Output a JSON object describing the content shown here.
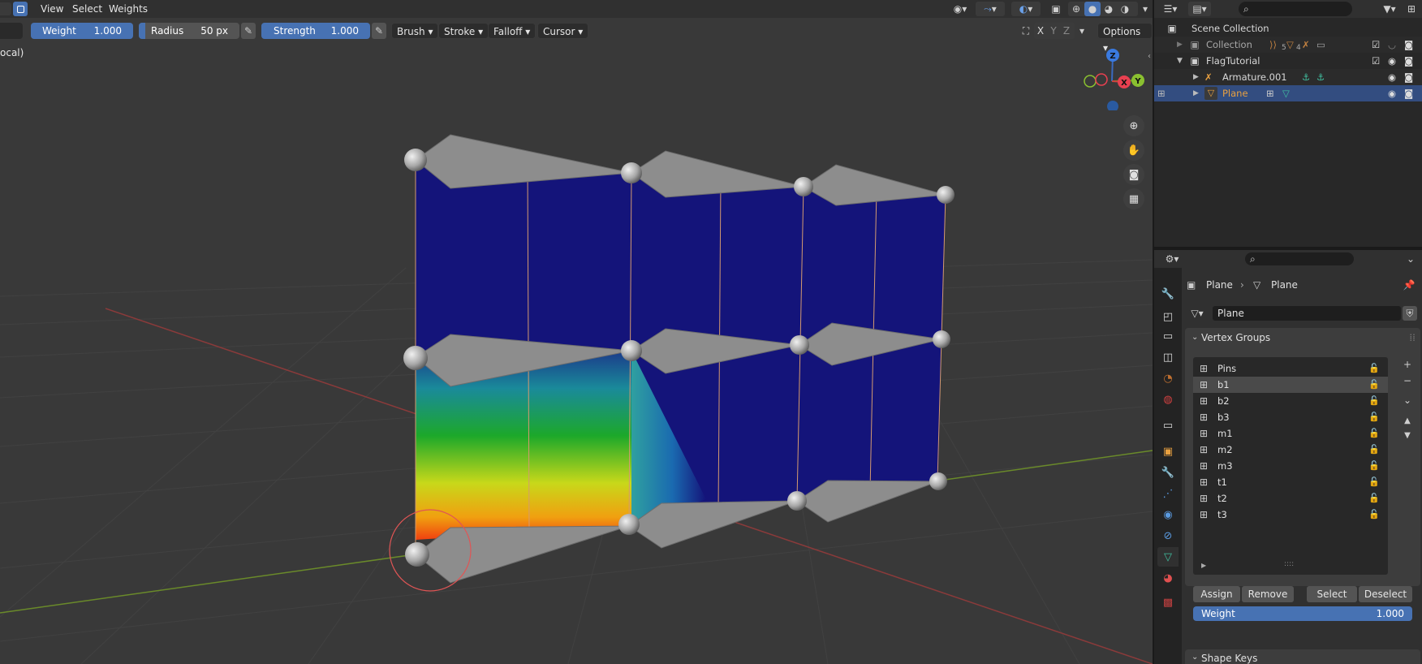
{
  "header": {
    "menus": [
      "View",
      "Select",
      "Weights"
    ]
  },
  "tool_settings": {
    "weight_label": "Weight",
    "weight_value": "1.000",
    "radius_label": "Radius",
    "radius_value": "50 px",
    "strength_label": "Strength",
    "strength_value": "1.000",
    "brush": "Brush",
    "stroke": "Stroke",
    "falloff": "Falloff",
    "cursor": "Cursor",
    "axes": [
      "X",
      "Y",
      "Z"
    ],
    "options": "Options"
  },
  "viewport": {
    "overlay_text": "ocal)",
    "gizmo": {
      "z": "Z",
      "y": "Y",
      "x": "X"
    }
  },
  "outliner": {
    "rows": [
      {
        "label": "Scene Collection"
      },
      {
        "label": "Collection"
      },
      {
        "label": "FlagTutorial"
      },
      {
        "label": "Armature.001"
      },
      {
        "label": "Plane"
      }
    ],
    "collection_counts": [
      "5",
      "4"
    ]
  },
  "properties": {
    "breadcrumb": [
      "Plane",
      "Plane"
    ],
    "mesh_name": "Plane",
    "vertex_groups_title": "Vertex Groups",
    "vertex_groups": [
      "Pins",
      "b1",
      "b2",
      "b3",
      "m1",
      "m2",
      "m3",
      "t1",
      "t2",
      "t3"
    ],
    "selected_group": "b1",
    "buttons": {
      "assign": "Assign",
      "remove": "Remove",
      "select": "Select",
      "deselect": "Deselect"
    },
    "weight_label": "Weight",
    "weight_value": "1.000",
    "shape_keys_title": "Shape Keys"
  },
  "colors": {
    "accent": "#4772b3",
    "selected_row": "#334d80",
    "orange_object": "#e8a040",
    "mesh_blue": "#14147a"
  }
}
